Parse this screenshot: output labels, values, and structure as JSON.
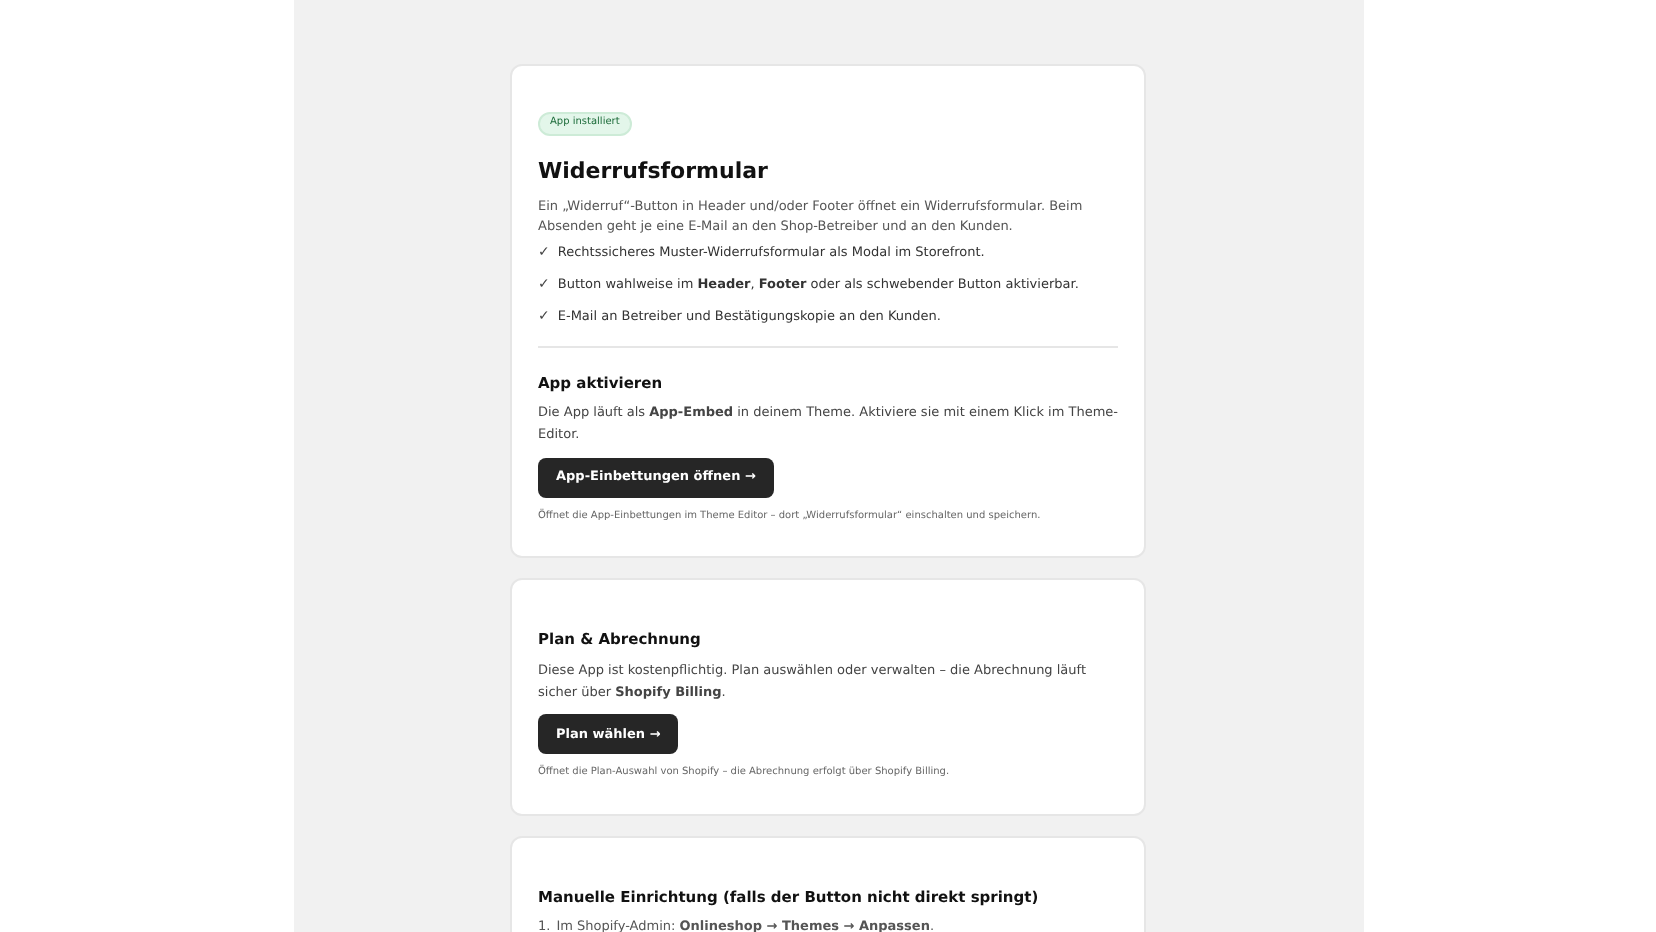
{
  "app_card": {
    "badge": "App installiert",
    "title": "Widerrufsformular",
    "description": "Ein „Widerruf“-Button in Header und/oder Footer öffnet ein Widerrufsformular. Beim Absenden geht je eine E-Mail an den Shop-Betreiber und an den Kunden.",
    "features": [
      {
        "mark": "✓",
        "text": "Rechtssicheres Muster-Widerrufsformular als Modal im Storefront."
      },
      {
        "mark": "✓",
        "text": "Button wahlweise im **Header**, **Footer** oder als schwebender Button aktivierbar."
      },
      {
        "mark": "✓",
        "text": "E-Mail an Betreiber und Bestätigungskopie an den Kunden."
      }
    ],
    "section_title": "App aktivieren",
    "section_text": "Die App läuft als **App-Embed** in deinem Theme. Aktiviere sie mit einem Klick im Theme-Editor.",
    "button": "App-Einbettungen öffnen →",
    "hint": "Öffnet die App-Einbettungen im Theme Editor – dort „Widerrufsformular“ einschalten und speichern."
  },
  "plan_card": {
    "title": "Plan & Abrechnung",
    "text": "Diese App ist kostenpflichtig. Plan auswählen oder verwalten – die Abrechnung läuft sicher über **Shopify Billing**.",
    "button": "Plan wählen →",
    "hint": "Öffnet die Plan-Auswahl von Shopify – die Abrechnung erfolgt über Shopify Billing."
  },
  "manual_card": {
    "title": "Manuelle Einrichtung (falls der Button nicht direkt springt)",
    "steps": [
      {
        "number": "1.",
        "text": "Im Shopify-Admin: **Onlineshop → Themes → Anpassen**."
      }
    ]
  }
}
